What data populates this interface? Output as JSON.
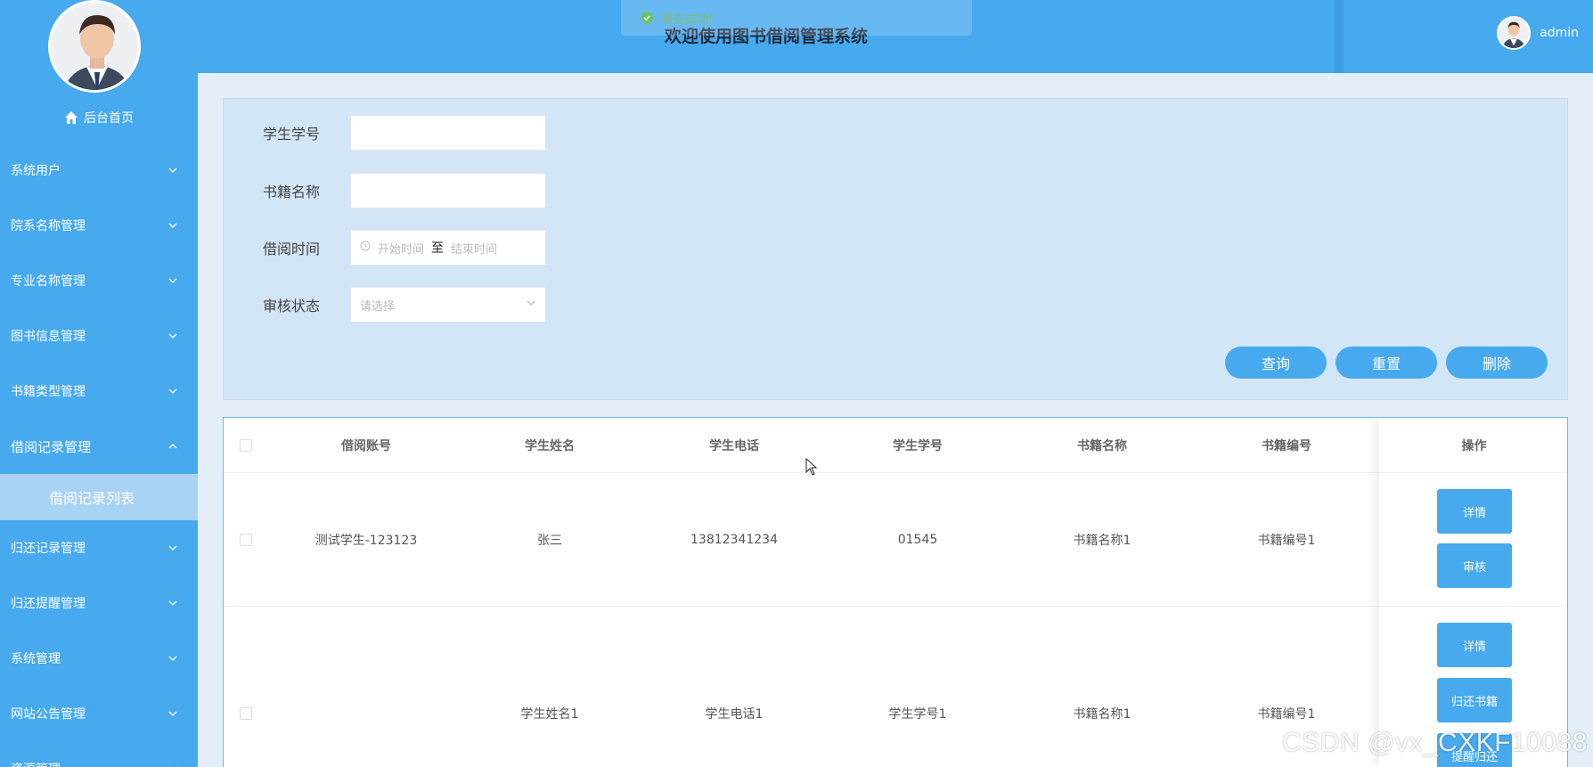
{
  "sidebar": {
    "home_label": "后台首页",
    "items": [
      {
        "label": "系统用户"
      },
      {
        "label": "院系名称管理"
      },
      {
        "label": "专业名称管理"
      },
      {
        "label": "图书信息管理"
      },
      {
        "label": "书籍类型管理"
      },
      {
        "label": "借阅记录管理"
      },
      {
        "label": "归还记录管理"
      },
      {
        "label": "归还提醒管理"
      },
      {
        "label": "系统管理"
      },
      {
        "label": "网站公告管理"
      },
      {
        "label": "资源管理"
      }
    ],
    "active_subitem": "借阅记录列表"
  },
  "topbar": {
    "title": "欢迎使用图书借阅管理系统",
    "toast": "提交成功!",
    "username": "admin"
  },
  "search": {
    "student_id_label": "学生学号",
    "book_name_label": "书籍名称",
    "borrow_time_label": "借阅时间",
    "start_placeholder": "开始时间",
    "range_sep": "至",
    "end_placeholder": "结束时间",
    "status_label": "审核状态",
    "status_placeholder": "请选择",
    "query_btn": "查询",
    "reset_btn": "重置",
    "delete_btn": "删除"
  },
  "table": {
    "headers": [
      "借阅账号",
      "学生姓名",
      "学生电话",
      "学生学号",
      "书籍名称",
      "书籍编号",
      "操作"
    ],
    "rows": [
      {
        "account": "测试学生-123123",
        "name": "张三",
        "phone": "13812341234",
        "student_id": "01545",
        "book_name": "书籍名称1",
        "book_no": "书籍编号1",
        "ops": [
          "详情",
          "审核"
        ]
      },
      {
        "account": "",
        "name": "学生姓名1",
        "phone": "学生电话1",
        "student_id": "学生学号1",
        "book_name": "书籍名称1",
        "book_no": "书籍编号1",
        "ops": [
          "详情",
          "归还书籍",
          "提醒归还"
        ]
      }
    ]
  },
  "watermark": "CSDN @vx_CXKF10088",
  "colors": {
    "primary": "#47a9ee",
    "panel": "#d2e6f7",
    "submenu": "#a9d3f5"
  }
}
